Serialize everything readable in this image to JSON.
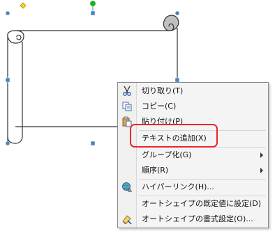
{
  "context_menu": {
    "items": [
      {
        "label": "切り取り(T)",
        "icon": "scissors-icon"
      },
      {
        "label": "コピー(C)",
        "icon": "copy-icon"
      },
      {
        "label": "貼り付け(P)",
        "icon": "paste-icon"
      },
      {
        "label": "テキストの追加(X)",
        "icon": ""
      },
      {
        "label": "グループ化(G)",
        "icon": "",
        "submenu": true
      },
      {
        "label": "順序(R)",
        "icon": "",
        "submenu": true
      },
      {
        "label": "ハイパーリンク(H)...",
        "icon": "hyperlink-globe-icon"
      },
      {
        "label": "オートシェイプの既定値に設定(D)",
        "icon": ""
      },
      {
        "label": "オートシェイプの書式設定(O)...",
        "icon": "format-shape-icon"
      }
    ]
  },
  "colors": {
    "highlight": "#e8252a",
    "handle": "#4f81bd",
    "rotation_handle": "#00c000",
    "adjust_handle": "#ffd700"
  }
}
